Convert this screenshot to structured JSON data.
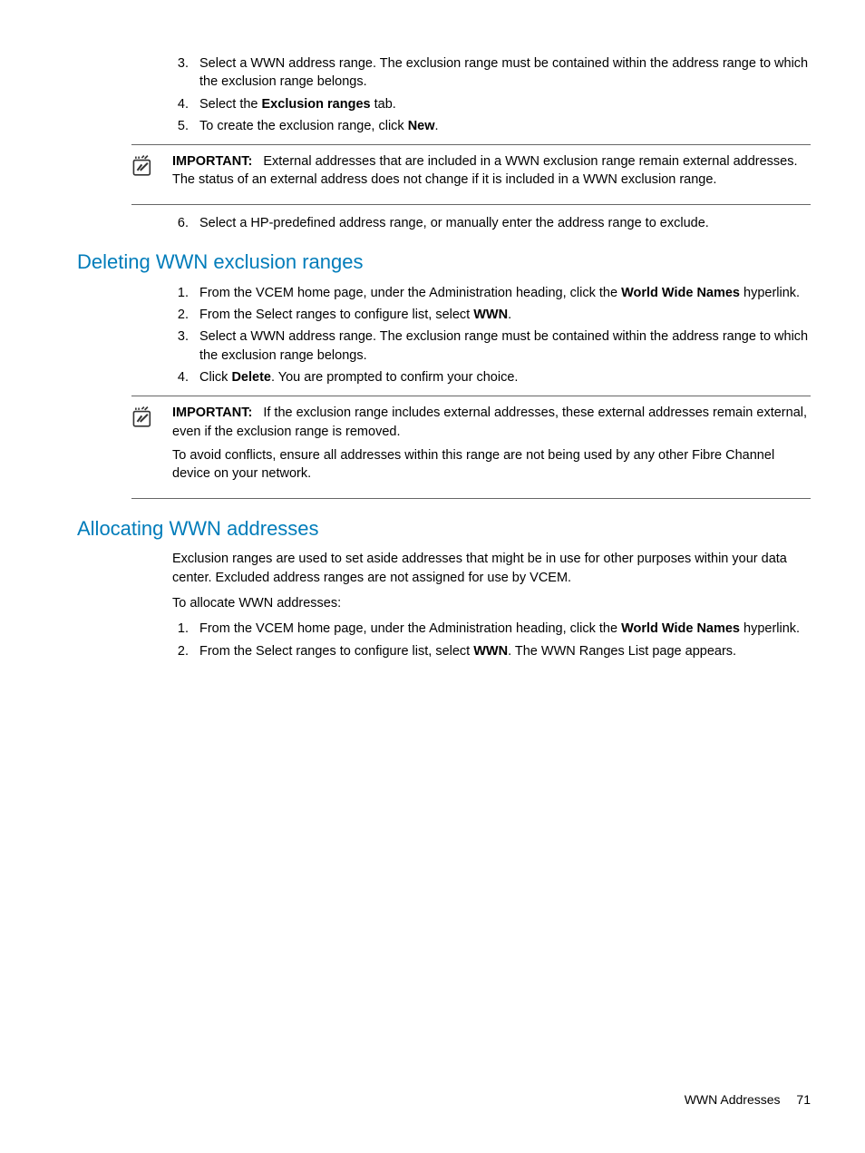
{
  "top_steps": [
    {
      "n": "3.",
      "text_before": "Select a WWN address range. The exclusion range must be contained within the address range to which the exclusion range belongs."
    },
    {
      "n": "4.",
      "text_before": "Select the ",
      "bold1": "Exclusion ranges",
      "text_after": " tab."
    },
    {
      "n": "5.",
      "text_before": "To create the exclusion range, click ",
      "bold1": "New",
      "text_after": "."
    }
  ],
  "note1": {
    "label": "IMPORTANT:",
    "text": "External addresses that are included in a WWN exclusion range remain external addresses. The status of an external address does not change if it is included in a WWN exclusion range."
  },
  "step6": {
    "n": "6.",
    "text": "Select a HP-predefined address range, or manually enter the address range to exclude."
  },
  "heading1": "Deleting WWN exclusion ranges",
  "del_steps": [
    {
      "n": "1.",
      "pre": "From the VCEM home page, under the Administration heading, click the ",
      "bold": "World Wide Names",
      "post": " hyperlink."
    },
    {
      "n": "2.",
      "pre": "From the Select ranges to configure list, select ",
      "bold": "WWN",
      "post": "."
    },
    {
      "n": "3.",
      "pre": "Select a WWN address range. The exclusion range must be contained within the address range to which the exclusion range belongs."
    },
    {
      "n": "4.",
      "pre": "Click ",
      "bold": "Delete",
      "post": ". You are prompted to confirm your choice."
    }
  ],
  "note2": {
    "label": "IMPORTANT:",
    "p1": "If the exclusion range includes external addresses, these external addresses remain external, even if the exclusion range is removed.",
    "p2": "To avoid conflicts, ensure all addresses within this range are not being used by any other Fibre Channel device on your network."
  },
  "heading2": "Allocating WWN addresses",
  "alloc_intro": "Exclusion ranges are used to set aside addresses that might be in use for other purposes within your data center. Excluded address ranges are not assigned for use by VCEM.",
  "alloc_lead": "To allocate WWN addresses:",
  "alloc_steps": [
    {
      "n": "1.",
      "pre": "From the VCEM home page, under the Administration heading, click the ",
      "bold": "World Wide Names",
      "post": " hyperlink."
    },
    {
      "n": "2.",
      "pre": "From the Select ranges to configure list, select ",
      "bold": "WWN",
      "post": ". The WWN Ranges List page appears."
    }
  ],
  "footer": {
    "title": "WWN Addresses",
    "page": "71"
  }
}
